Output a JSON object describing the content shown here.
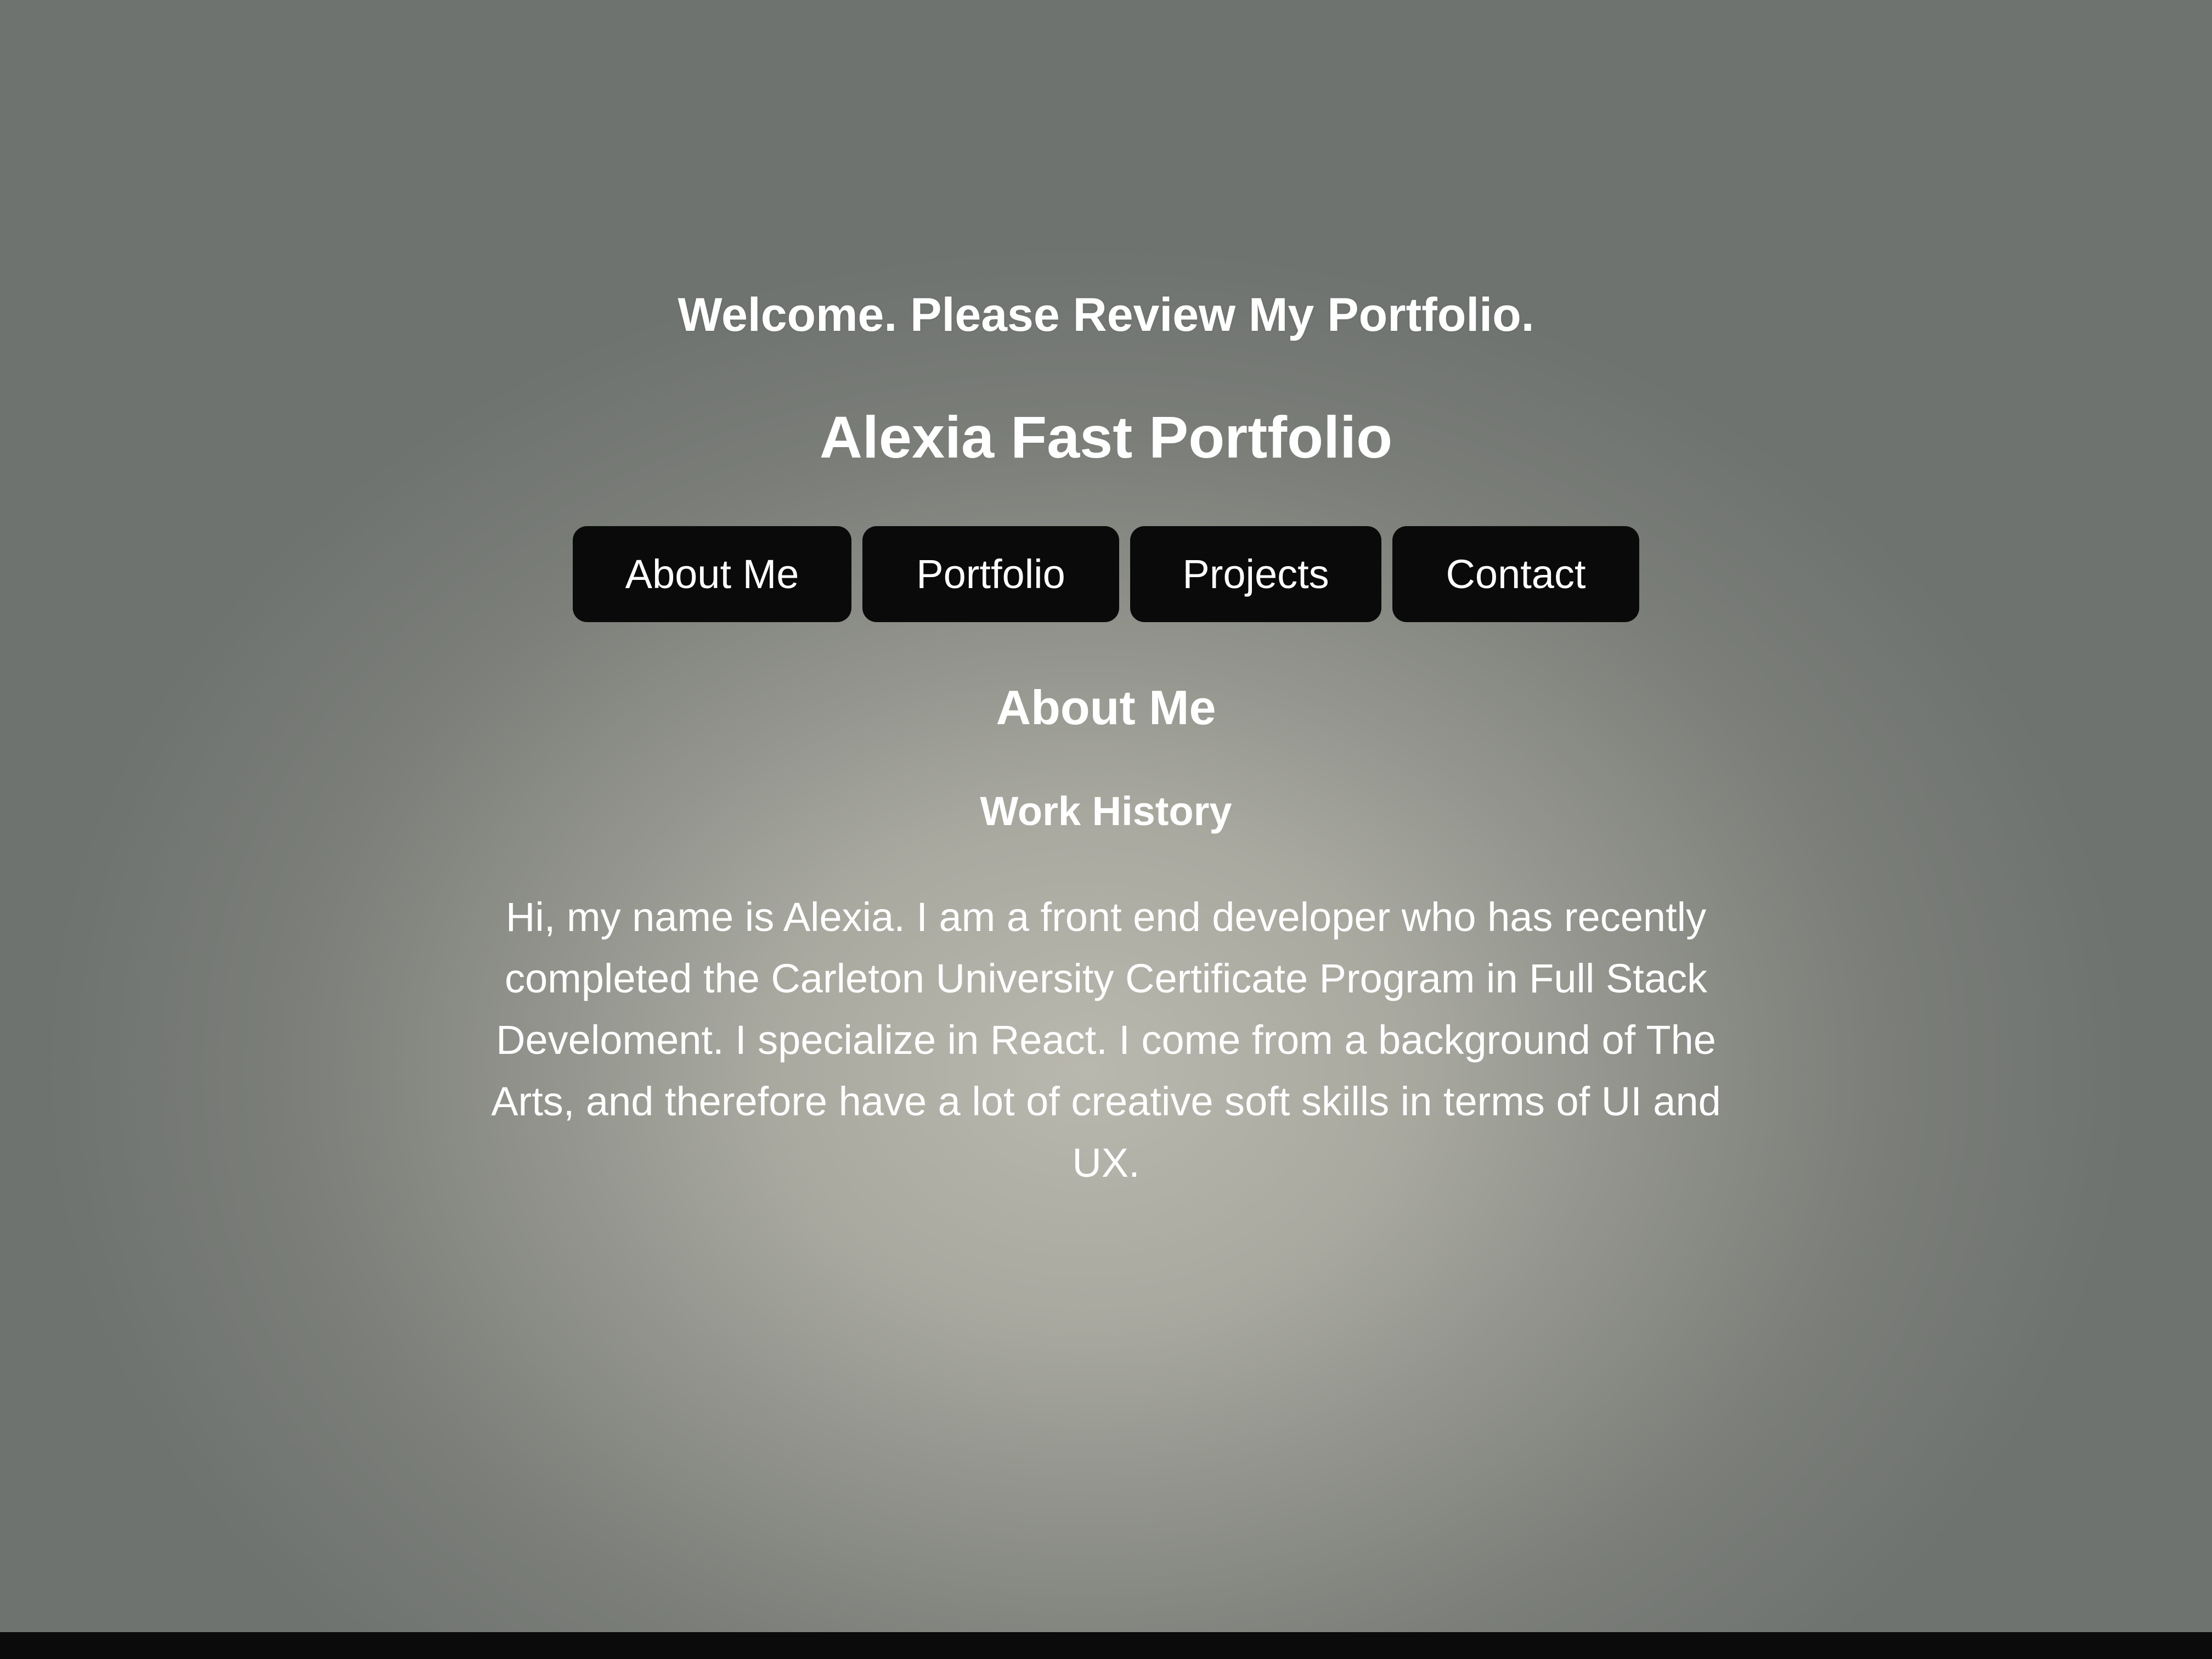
{
  "header": {
    "welcome": "Welcome. Please Review My Portfolio.",
    "title": "Alexia Fast Portfolio"
  },
  "nav": {
    "items": [
      {
        "label": "About Me"
      },
      {
        "label": "Portfolio"
      },
      {
        "label": "Projects"
      },
      {
        "label": "Contact"
      }
    ]
  },
  "main": {
    "section_title": "About Me",
    "subsection_title": "Work History",
    "bio": "Hi, my name is Alexia. I am a front end developer who has recently completed the Carleton University Certificate Program in Full Stack Develoment. I specialize in React. I come from a background of The Arts, and therefore have a lot of creative soft skills in terms of UI and UX."
  },
  "colors": {
    "button_bg": "#0a0a0a",
    "text": "#ffffff",
    "background": "#a9a9a0"
  }
}
